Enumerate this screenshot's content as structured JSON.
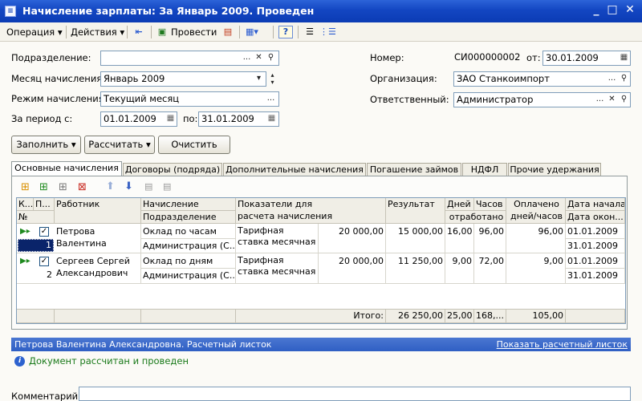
{
  "window": {
    "title": "Начисление зарплаты: За Январь 2009. Проведен",
    "minimize": "_",
    "maximize": "□",
    "close": "✕"
  },
  "menu": {
    "operation": "Операция",
    "actions": "Действия",
    "post": "Провести"
  },
  "form": {
    "subdivision_label": "Подразделение:",
    "subdivision_value": "",
    "month_label": "Месяц начисления:",
    "month_value": "Январь 2009",
    "mode_label": "Режим начисления:",
    "mode_value": "Текущий месяц",
    "period_label": "За период с:",
    "period_from": "01.01.2009",
    "period_to_label": "по:",
    "period_to": "31.01.2009",
    "number_label": "Номер:",
    "number_value": "СИ000000002",
    "from_label": "от:",
    "date_value": "30.01.2009",
    "org_label": "Организация:",
    "org_value": "ЗАО Станкоимпорт",
    "resp_label": "Ответственный:",
    "resp_value": "Администратор"
  },
  "buttons": {
    "fill": "Заполнить",
    "calculate": "Рассчитать",
    "clear": "Очистить"
  },
  "tabs": [
    "Основные начисления",
    "Договоры (подряда)",
    "Дополнительные начисления",
    "Погашение займов",
    "НДФЛ",
    "Прочие удержания"
  ],
  "table": {
    "headers": {
      "k": "К...",
      "p": "П...",
      "num": "№",
      "employee": "Работник",
      "accrual": "Начисление",
      "subdivision": "Подразделение",
      "indicators": "Показатели для расчета начисления",
      "result": "Результат",
      "days": "Дней",
      "hours": "Часов",
      "worked": "отработано",
      "paid": "Оплачено дней/часов",
      "date_start": "Дата начала",
      "date_end": "Дата окон..."
    },
    "rows": [
      {
        "num": "1",
        "employee": "Петрова Валентина",
        "accrual": "Оклад по часам",
        "subdivision": "Администрация (С...",
        "indicator": "Тарифная ставка месячная",
        "amount": "20 000,00",
        "result": "15 000,00",
        "days": "16,00",
        "hours": "96,00",
        "paid": "96,00",
        "date_start": "01.01.2009",
        "date_end": "31.01.2009"
      },
      {
        "num": "2",
        "employee": "Сергеев Сергей Александрович",
        "accrual": "Оклад по дням",
        "subdivision": "Администрация (С...",
        "indicator": "Тарифная ставка месячная",
        "amount": "20 000,00",
        "result": "11 250,00",
        "days": "9,00",
        "hours": "72,00",
        "paid": "9,00",
        "date_start": "01.01.2009",
        "date_end": "31.01.2009"
      }
    ],
    "totals": {
      "label": "Итого:",
      "result": "26 250,00",
      "days": "25,00",
      "hours": "168,...",
      "paid": "105,00"
    }
  },
  "status": {
    "text": "Петрова Валентина Александровна. Расчетный листок",
    "link": "Показать расчетный листок",
    "info": "Документ рассчитан и проведен"
  },
  "comment": {
    "label": "Комментарий:",
    "value": ""
  }
}
